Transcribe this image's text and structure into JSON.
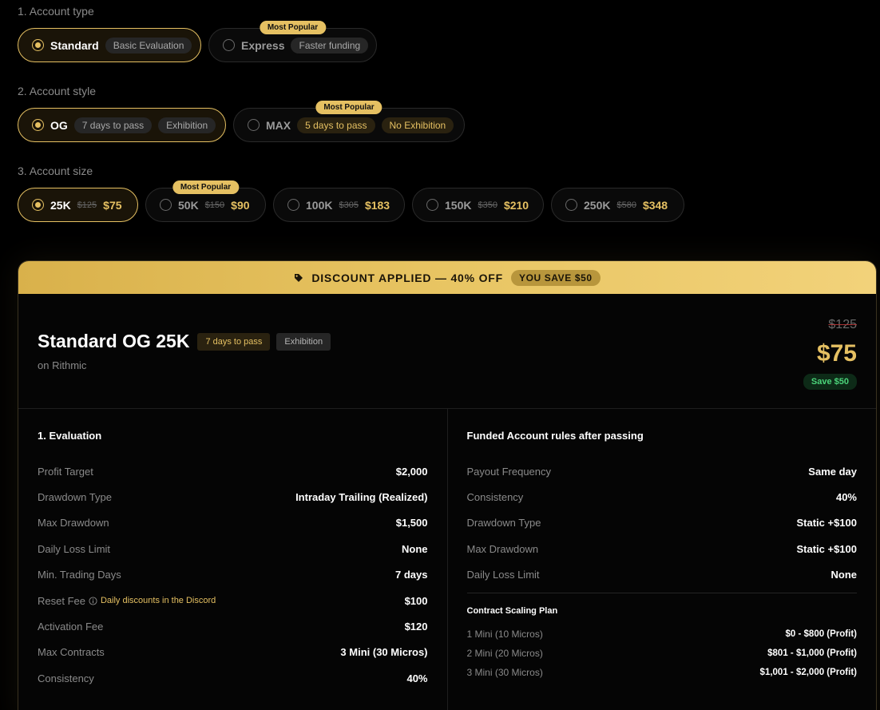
{
  "sections": {
    "account_type": {
      "label": "1. Account type",
      "options": [
        {
          "name": "Standard",
          "chip": "Basic Evaluation",
          "selected": true
        },
        {
          "name": "Express",
          "chip": "Faster funding",
          "badge": "Most Popular",
          "selected": false
        }
      ]
    },
    "account_style": {
      "label": "2. Account style",
      "options": [
        {
          "name": "OG",
          "chips": [
            "7 days to pass",
            "Exhibition"
          ],
          "selected": true
        },
        {
          "name": "MAX",
          "chips": [
            "5 days to pass",
            "No Exhibition"
          ],
          "badge": "Most Popular",
          "selected": false
        }
      ]
    },
    "account_size": {
      "label": "3. Account size",
      "options": [
        {
          "name": "25K",
          "old": "$125",
          "price": "$75",
          "selected": true
        },
        {
          "name": "50K",
          "old": "$150",
          "price": "$90",
          "badge": "Most Popular",
          "selected": false
        },
        {
          "name": "100K",
          "old": "$305",
          "price": "$183",
          "selected": false
        },
        {
          "name": "150K",
          "old": "$350",
          "price": "$210",
          "selected": false
        },
        {
          "name": "250K",
          "old": "$580",
          "price": "$348",
          "selected": false
        }
      ]
    }
  },
  "card": {
    "banner": {
      "text": "DISCOUNT APPLIED — 40% OFF",
      "save": "YOU SAVE $50",
      "icon": "tag-icon"
    },
    "title": "Standard OG 25K",
    "chips": [
      "7 days to pass",
      "Exhibition"
    ],
    "subtitle": "on Rithmic",
    "old_price": "$125",
    "price": "$75",
    "save": "Save $50",
    "evaluation": {
      "title": "1. Evaluation",
      "rows": [
        {
          "k": "Profit Target",
          "v": "$2,000"
        },
        {
          "k": "Drawdown Type",
          "v": "Intraday Trailing (Realized)"
        },
        {
          "k": "Max Drawdown",
          "v": "$1,500"
        },
        {
          "k": "Daily Loss Limit",
          "v": "None"
        },
        {
          "k": "Min. Trading Days",
          "v": "7 days"
        },
        {
          "k": "Reset Fee",
          "v": "$100",
          "note": "Daily discounts in the Discord"
        },
        {
          "k": "Activation Fee",
          "v": "$120"
        },
        {
          "k": "Max Contracts",
          "v": "3 Mini (30 Micros)"
        },
        {
          "k": "Consistency",
          "v": "40%"
        }
      ]
    },
    "funded": {
      "title": "Funded Account rules after passing",
      "rows": [
        {
          "k": "Payout Frequency",
          "v": "Same day"
        },
        {
          "k": "Consistency",
          "v": "40%"
        },
        {
          "k": "Drawdown Type",
          "v": "Static +$100"
        },
        {
          "k": "Max Drawdown",
          "v": "Static +$100"
        },
        {
          "k": "Daily Loss Limit",
          "v": "None"
        }
      ],
      "scaling_title": "Contract Scaling Plan",
      "scaling": [
        {
          "k": "1 Mini (10 Micros)",
          "v": "$0 - $800 (Profit)"
        },
        {
          "k": "2 Mini (20 Micros)",
          "v": "$801 - $1,000 (Profit)"
        },
        {
          "k": "3 Mini (30 Micros)",
          "v": "$1,001 - $2,000 (Profit)"
        }
      ]
    }
  },
  "colors": {
    "accent": "#e5c062",
    "save_green": "#4bd37a"
  }
}
